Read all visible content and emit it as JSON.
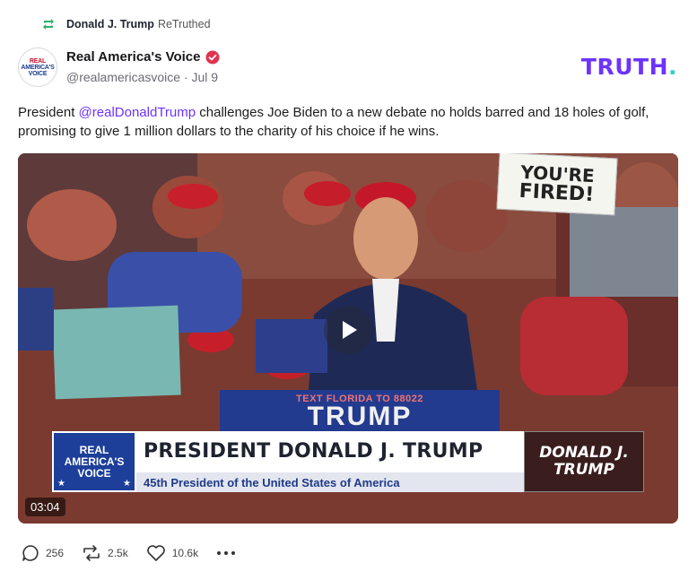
{
  "retruth": {
    "user": "Donald J. Trump",
    "suffix": "ReTruthed",
    "icon": "retruth-icon"
  },
  "author": {
    "display_name": "Real America's Voice",
    "handle": "@realamericasvoice",
    "separator": "·",
    "date": "Jul 9",
    "avatar_lines": [
      "REAL",
      "AMERICA'S",
      "VOICE"
    ],
    "verified_icon": "verified-badge-icon"
  },
  "brand": {
    "logo_text": "TRUTH",
    "logo_dot": ".",
    "color": "#6c33ff",
    "dot_color": "#2ed3c3"
  },
  "post": {
    "prefix": "President ",
    "mention": "@realDonaldTrump",
    "body": " challenges Joe Biden to a new debate no holds barred and 18 holes of golf, promising to give 1 million dollars to the charity of his choice if he wins."
  },
  "video": {
    "duration": "03:04",
    "play_icon": "play-icon",
    "sign_text_1": "YOU'RE",
    "sign_text_2": "FIRED!",
    "podium_small": "TEXT FLORIDA TO 88022",
    "podium_large": "TRUMP",
    "lower_third": {
      "logo_line1": "REAL",
      "logo_line2": "AMERICA'S",
      "logo_line3": "VOICE",
      "title": "PRESIDENT DONALD J. TRUMP",
      "subtitle": "45th President of the United States of America",
      "badge_line1": "DONALD J.",
      "badge_line2": "TRUMP"
    }
  },
  "actions": {
    "replies": "256",
    "retruths": "2.5k",
    "likes": "10.6k",
    "reply_icon": "reply-icon",
    "retruth_icon": "retruth-icon",
    "like_icon": "heart-icon",
    "more_icon": "more-icon"
  }
}
